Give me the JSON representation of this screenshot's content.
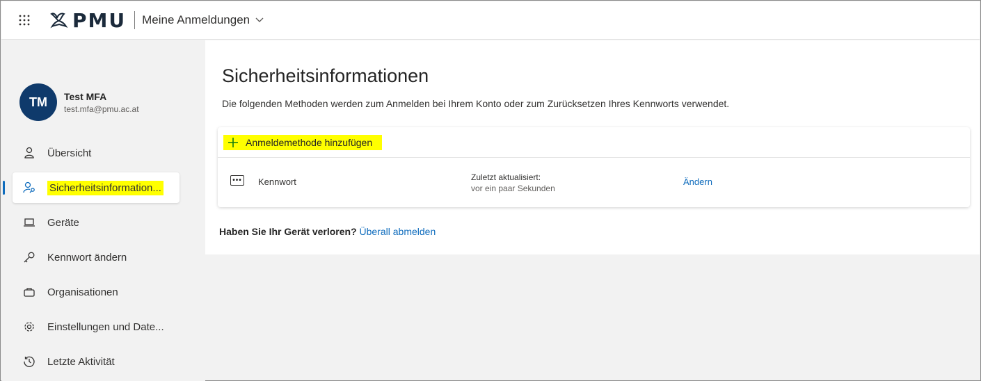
{
  "header": {
    "logo_text": "PMU",
    "app_title": "Meine Anmeldungen"
  },
  "profile": {
    "initials": "TM",
    "name": "Test MFA",
    "email": "test.mfa@pmu.ac.at"
  },
  "nav": {
    "items": [
      {
        "label": "Übersicht",
        "icon": "person-icon"
      },
      {
        "label": "Sicherheitsinformation...",
        "icon": "person-key-icon",
        "active": true,
        "highlighted": true
      },
      {
        "label": "Geräte",
        "icon": "laptop-icon"
      },
      {
        "label": "Kennwort ändern",
        "icon": "key-icon"
      },
      {
        "label": "Organisationen",
        "icon": "briefcase-icon"
      },
      {
        "label": "Einstellungen und Date...",
        "icon": "gear-icon"
      },
      {
        "label": "Letzte Aktivität",
        "icon": "history-icon"
      }
    ]
  },
  "main": {
    "title": "Sicherheitsinformationen",
    "subtitle": "Die folgenden Methoden werden zum Anmelden bei Ihrem Konto oder zum Zurücksetzen Ihres Kennworts verwendet.",
    "add_method_label": "Anmeldemethode hinzufügen",
    "method": {
      "name": "Kennwort",
      "updated_label": "Zuletzt aktualisiert:",
      "updated_value": "vor ein paar Sekunden",
      "change_label": "Ändern"
    },
    "lost_device_question": "Haben Sie Ihr Gerät verloren?",
    "sign_out_everywhere": "Überall abmelden"
  },
  "colors": {
    "accent": "#0f6cbd",
    "highlight": "#ffff00",
    "avatar_bg": "#0f3a6b",
    "page_bg": "#f2f2f2"
  }
}
